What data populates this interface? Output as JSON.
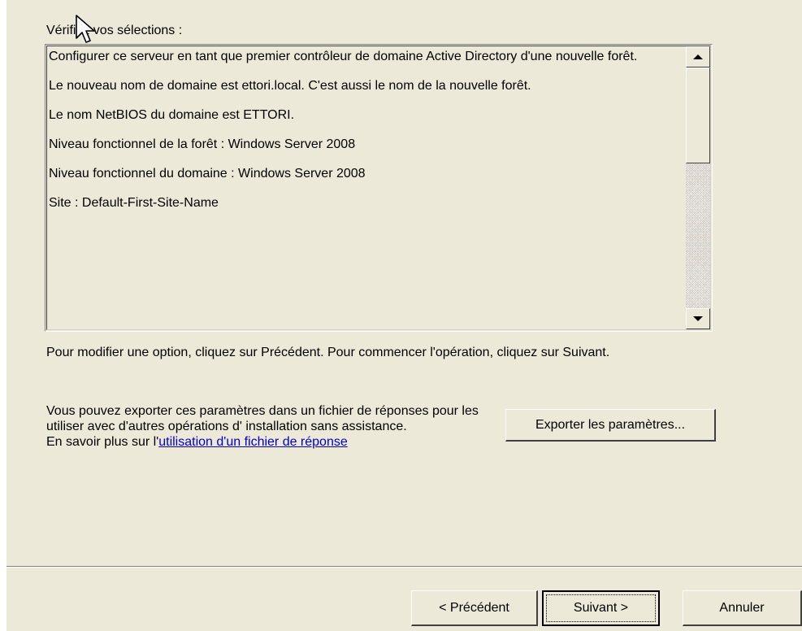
{
  "review": {
    "label": "Vérifiez vos sélections :"
  },
  "summary_list": {
    "entries": [
      "Configurer ce serveur en tant que premier contrôleur de domaine Active Directory d'une nouvelle forêt.",
      "Le nouveau nom de domaine est ettori.local. C'est aussi le nom de la nouvelle forêt.",
      "Le nom NetBIOS du domaine est ETTORI.",
      "Niveau fonctionnel de la forêt : Windows Server 2008",
      "Niveau fonctionnel du domaine : Windows Server 2008",
      "Site : Default-First-Site-Name"
    ]
  },
  "instructions": {
    "text": "Pour modifier une option, cliquez sur Précédent. Pour commencer l'opération, cliquez sur Suivant."
  },
  "export": {
    "description": "Vous pouvez exporter ces paramètres dans un fichier de réponses pour les utiliser avec d'autres opérations d' installation sans assistance.",
    "learn_more_prefix": "En savoir plus sur l'",
    "learn_more_link": "utilisation d'un fichier de réponse",
    "button_label": "Exporter les paramètres..."
  },
  "footer": {
    "previous_label": "< Précédent",
    "next_label": "Suivant >",
    "cancel_label": "Annuler"
  },
  "colors": {
    "background": "#ece9d8",
    "link": "#0000cc"
  }
}
